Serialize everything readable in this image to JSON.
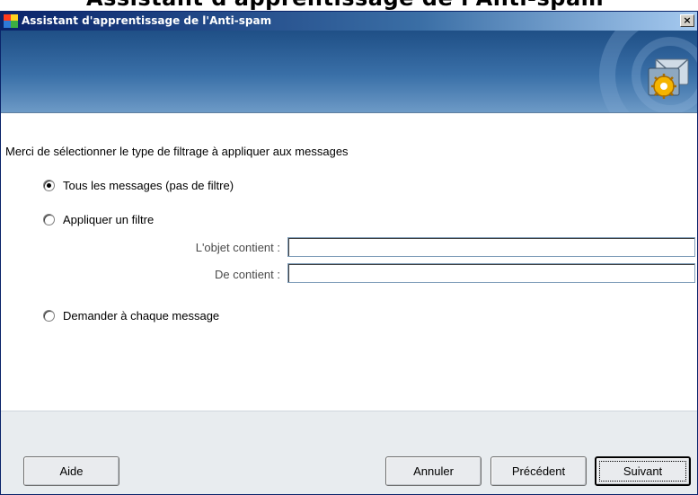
{
  "cropped_heading": "Assistant d'apprentissage de l'Anti-spam",
  "window": {
    "title": "Assistant d'apprentissage de l'Anti-spam",
    "close_label": "×"
  },
  "content": {
    "instruction": "Merci de sélectionner le type de filtrage à appliquer aux messages",
    "options": [
      {
        "label": "Tous les messages (pas de filtre)",
        "checked": true
      },
      {
        "label": "Appliquer un filtre",
        "checked": false
      },
      {
        "label": "Demander à chaque message",
        "checked": false
      }
    ],
    "fields": [
      {
        "label": "L'objet contient :",
        "value": ""
      },
      {
        "label": "De contient :",
        "value": ""
      }
    ]
  },
  "buttons": {
    "help": "Aide",
    "cancel": "Annuler",
    "previous": "Précédent",
    "next": "Suivant"
  },
  "colors": {
    "titlebar_start": "#0a246a",
    "banner": "#2f5f96",
    "footer_bg": "#e8ecef"
  }
}
